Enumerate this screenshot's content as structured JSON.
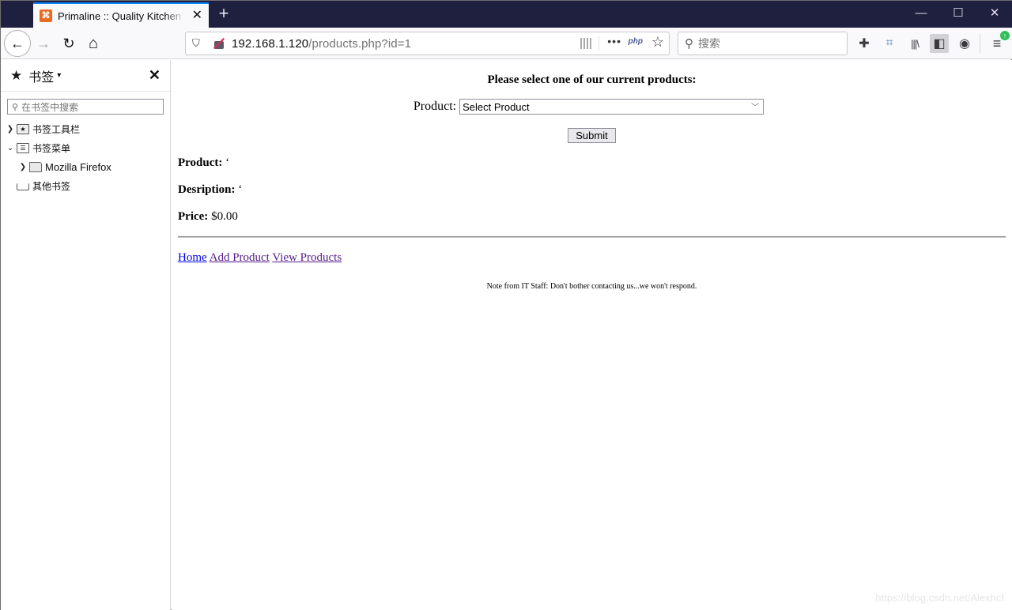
{
  "browser": {
    "tab": {
      "title": "Primaline :: Quality Kitchen Appliances",
      "favicon": "xampp-icon"
    },
    "new_tab_label": "+",
    "window_controls": {
      "minimize": "—",
      "maximize": "☐",
      "close": "✕"
    },
    "url": {
      "host": "192.168.1.120",
      "path": "/products.php?id=1"
    },
    "search_placeholder": "搜索",
    "icons": {
      "back": "←",
      "forward": "→",
      "reload": "↻",
      "home": "⌂",
      "more": "•••",
      "php": "php",
      "star": "☆",
      "search": "⚲",
      "extensions": "✚",
      "crop": "⌗",
      "library": "|||\\",
      "sidebar": "◧",
      "account": "◉",
      "menu": "≡",
      "update_badge": "↑"
    }
  },
  "sidebar": {
    "title": "书签",
    "search_placeholder": "在书签中搜索",
    "close": "✕",
    "items": [
      {
        "label": "书签工具栏",
        "twisty": "›",
        "icon": "bookmarks-toolbar-icon",
        "level": 0
      },
      {
        "label": "书签菜单",
        "twisty": "⌄",
        "icon": "bookmarks-menu-icon",
        "level": 0
      },
      {
        "label": "Mozilla Firefox",
        "twisty": "›",
        "icon": "folder-icon",
        "level": 1
      },
      {
        "label": "其他书签",
        "twisty": "",
        "icon": "other-bookmarks-icon",
        "level": 0
      }
    ]
  },
  "page": {
    "heading": "Please select one of our current products:",
    "product_label": "Product:",
    "select_value": "Select Product",
    "submit_label": "Submit",
    "product_field": {
      "label": "Product:",
      "value": "‘"
    },
    "description_field": {
      "label": "Desription:",
      "value": "‘"
    },
    "price_field": {
      "label": "Price:",
      "value": "$0.00"
    },
    "links": [
      {
        "label": "Home"
      },
      {
        "label": "Add Product"
      },
      {
        "label": "View Products"
      }
    ],
    "note": "Note from IT Staff: Don't bother contacting us...we won't respond."
  },
  "watermark": "https://blog.csdn.net/Alexhcf"
}
